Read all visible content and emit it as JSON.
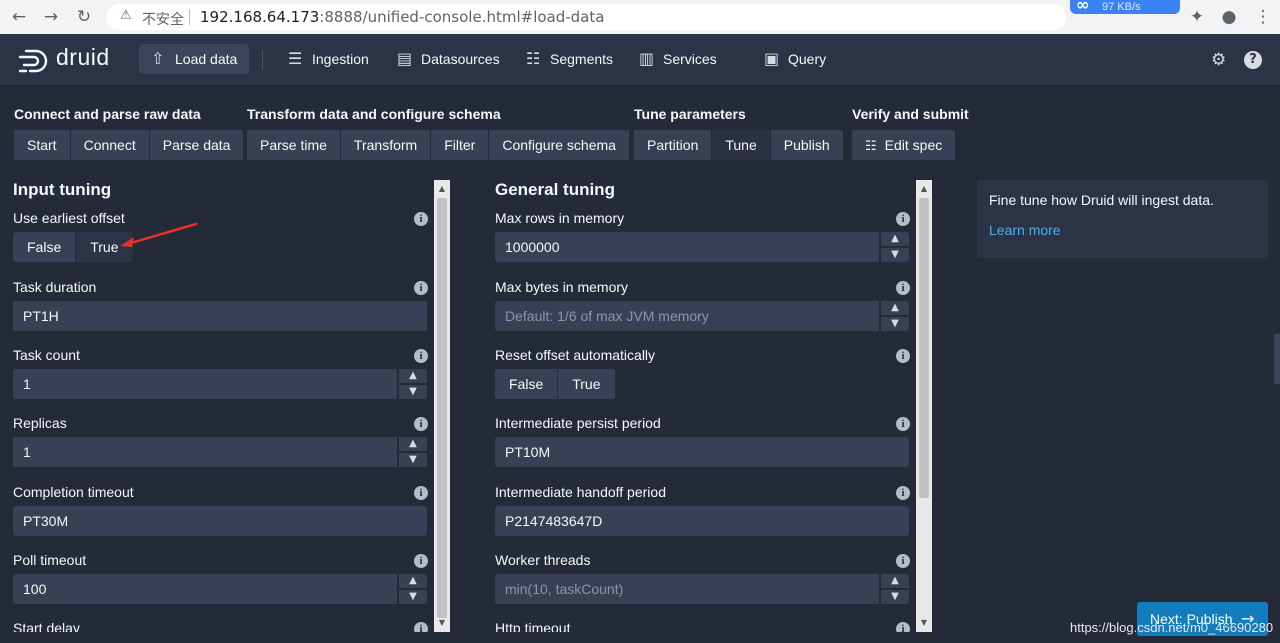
{
  "browser": {
    "back_icon": "←",
    "forward_icon": "→",
    "reload_icon": "↻",
    "warning_icon": "⚠",
    "insecure_label": "不安全",
    "url_host": "192.168.64.173",
    "url_rest": ":8888/unified-console.html#load-data",
    "speed_badge": "97 KB/s",
    "speed_logo": "∞",
    "extension_icon": "✦",
    "profile_icon": "●",
    "menu_icon": "⋮"
  },
  "navbar": {
    "logo": "druid",
    "items": [
      {
        "label": "Load data",
        "icon": "⇧"
      },
      {
        "label": "Ingestion",
        "icon": "☰"
      },
      {
        "label": "Datasources",
        "icon": "▤"
      },
      {
        "label": "Segments",
        "icon": "☷"
      },
      {
        "label": "Services",
        "icon": "▥"
      },
      {
        "label": "Query",
        "icon": "▣"
      }
    ],
    "settings_icon": "⚙",
    "help_icon": "?"
  },
  "steps": {
    "groups": [
      {
        "title": "Connect and parse raw data",
        "buttons": [
          "Start",
          "Connect",
          "Parse data"
        ]
      },
      {
        "title": "Transform data and configure schema",
        "buttons": [
          "Parse time",
          "Transform",
          "Filter",
          "Configure schema"
        ]
      },
      {
        "title": "Tune parameters",
        "buttons": [
          "Partition",
          "Tune",
          "Publish"
        ]
      },
      {
        "title": "Verify and submit",
        "buttons": [
          "Edit spec"
        ]
      }
    ],
    "edit_icon": "☷"
  },
  "input_tuning": {
    "title": "Input tuning",
    "use_earliest_offset": {
      "label": "Use earliest offset",
      "options": [
        "False",
        "True"
      ],
      "selected": "True"
    },
    "task_duration": {
      "label": "Task duration",
      "value": "PT1H"
    },
    "task_count": {
      "label": "Task count",
      "value": "1"
    },
    "replicas": {
      "label": "Replicas",
      "value": "1"
    },
    "completion_timeout": {
      "label": "Completion timeout",
      "value": "PT30M"
    },
    "poll_timeout": {
      "label": "Poll timeout",
      "value": "100"
    },
    "start_delay": {
      "label": "Start delay"
    }
  },
  "general_tuning": {
    "title": "General tuning",
    "max_rows_in_memory": {
      "label": "Max rows in memory",
      "value": "1000000"
    },
    "max_bytes_in_memory": {
      "label": "Max bytes in memory",
      "placeholder": "Default: 1/6 of max JVM memory"
    },
    "reset_offset_automatically": {
      "label": "Reset offset automatically",
      "options": [
        "False",
        "True"
      ],
      "selected": "True"
    },
    "intermediate_persist_period": {
      "label": "Intermediate persist period",
      "value": "PT10M"
    },
    "intermediate_handoff_period": {
      "label": "Intermediate handoff period",
      "value": "P2147483647D"
    },
    "worker_threads": {
      "label": "Worker threads",
      "placeholder": "min(10, taskCount)"
    },
    "http_timeout": {
      "label": "Http timeout"
    }
  },
  "help": {
    "text": "Fine tune how Druid will ingest data.",
    "link": "Learn more"
  },
  "next_button": {
    "label": "Next: Publish",
    "icon": "→"
  },
  "watermark": "https://blog.csdn.net/m0_46690280",
  "info_icon": "i",
  "stepper_up": "▲",
  "stepper_down": "▼",
  "colors": {
    "accent": "#137cbd",
    "link": "#48aff0",
    "background": "#252a39",
    "arrow": "#e8312a"
  }
}
